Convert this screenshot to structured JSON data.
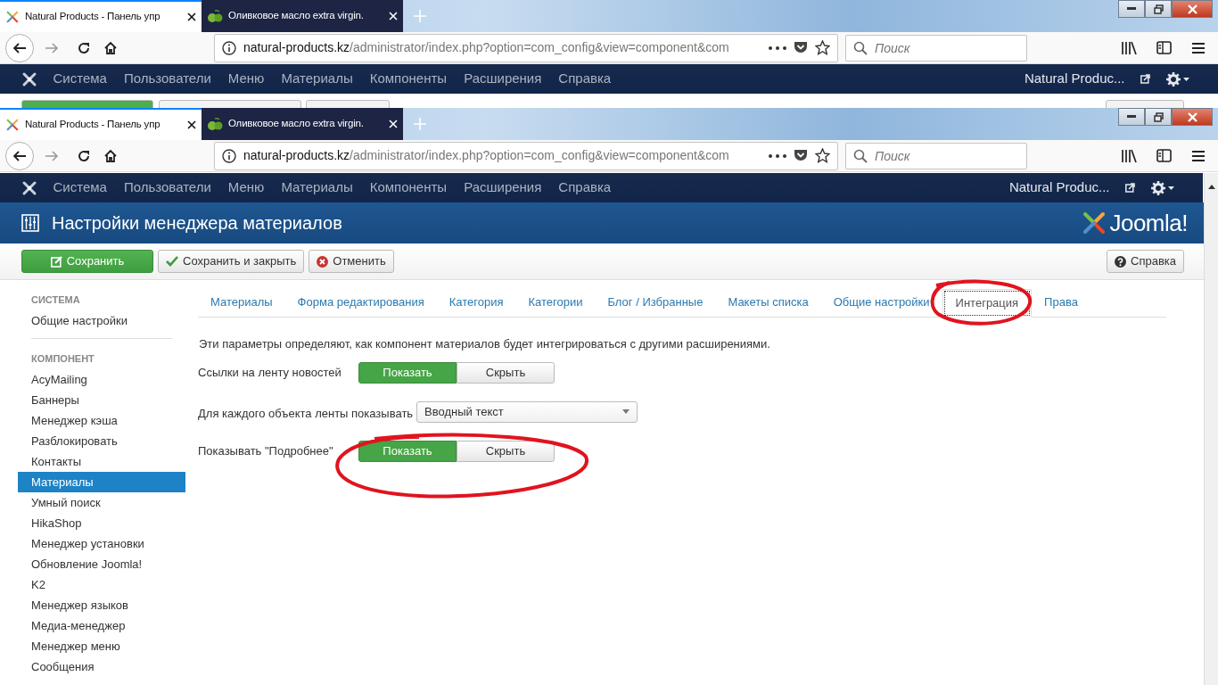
{
  "browser_windows": [
    {
      "tabs": [
        {
          "title": "Natural Products - Панель упр",
          "selected": true
        },
        {
          "title": "Оливковое масло extra virgin.",
          "selected": false
        }
      ],
      "url": {
        "host": "natural-products.kz",
        "path": "/administrator/index.php?option=com_config&view=component&com"
      },
      "search": {
        "placeholder": "Поиск"
      },
      "admin_menu": [
        "Система",
        "Пользователи",
        "Меню",
        "Материалы",
        "Компоненты",
        "Расширения",
        "Справка"
      ],
      "site_link": "Natural Produc..."
    },
    {
      "tabs": [
        {
          "title": "Natural Products - Панель упр",
          "selected": true
        },
        {
          "title": "Оливковое масло extra virgin.",
          "selected": false
        }
      ],
      "url": {
        "host": "natural-products.kz",
        "path": "/administrator/index.php?option=com_config&view=component&com"
      },
      "search": {
        "placeholder": "Поиск"
      },
      "admin_menu": [
        "Система",
        "Пользователи",
        "Меню",
        "Материалы",
        "Компоненты",
        "Расширения",
        "Справка"
      ],
      "site_link": "Natural Produc..."
    }
  ],
  "page": {
    "title": "Настройки менеджера материалов",
    "brand": "Joomla!",
    "toolbar": [
      {
        "label": "Сохранить"
      },
      {
        "label": "Сохранить и закрыть"
      },
      {
        "label": "Отменить"
      }
    ],
    "help_button": {
      "label": "Справка"
    },
    "sidebar": [
      {
        "heading": "СИСТЕМА",
        "items": [
          {
            "label": "Общие настройки",
            "selected": false
          }
        ]
      },
      {
        "heading": "КОМПОНЕНТ",
        "items": [
          {
            "label": "AcyMailing",
            "selected": false
          },
          {
            "label": "Баннеры",
            "selected": false
          },
          {
            "label": "Менеджер кэша",
            "selected": false
          },
          {
            "label": "Разблокировать",
            "selected": false
          },
          {
            "label": "Контакты",
            "selected": false
          },
          {
            "label": "Материалы",
            "selected": true
          },
          {
            "label": "Умный поиск",
            "selected": false
          },
          {
            "label": "HikaShop",
            "selected": false
          },
          {
            "label": "Менеджер установки",
            "selected": false
          },
          {
            "label": "Обновление Joomla!",
            "selected": false
          },
          {
            "label": "K2",
            "selected": false
          },
          {
            "label": "Менеджер языков",
            "selected": false
          },
          {
            "label": "Медиа-менеджер",
            "selected": false
          },
          {
            "label": "Менеджер меню",
            "selected": false
          },
          {
            "label": "Сообщения",
            "selected": false
          }
        ]
      }
    ],
    "tabs": [
      {
        "label": "Материалы",
        "selected": false
      },
      {
        "label": "Форма редактирования",
        "selected": false
      },
      {
        "label": "Категория",
        "selected": false
      },
      {
        "label": "Категории",
        "selected": false
      },
      {
        "label": "Блог / Избранные",
        "selected": false
      },
      {
        "label": "Макеты списка",
        "selected": false
      },
      {
        "label": "Общие настройки",
        "selected": false
      },
      {
        "label": "Интеграция",
        "selected": true
      },
      {
        "label": "Права",
        "selected": false
      }
    ],
    "description": "Эти параметры определяют, как компонент материалов будет интегрироваться с другими расширениями.",
    "fields": [
      {
        "kind": "toggle",
        "label": "Ссылки на ленту новостей",
        "options": [
          {
            "label": "Показать",
            "selected": true
          },
          {
            "label": "Скрыть",
            "selected": false
          }
        ]
      },
      {
        "kind": "select",
        "label": "Для каждого объекта ленты показывать",
        "value": "Вводный текст"
      },
      {
        "kind": "toggle",
        "label": "Показывать \"Подробнее\"",
        "options": [
          {
            "label": "Показать",
            "selected": true
          },
          {
            "label": "Скрыть",
            "selected": false
          }
        ]
      }
    ]
  }
}
